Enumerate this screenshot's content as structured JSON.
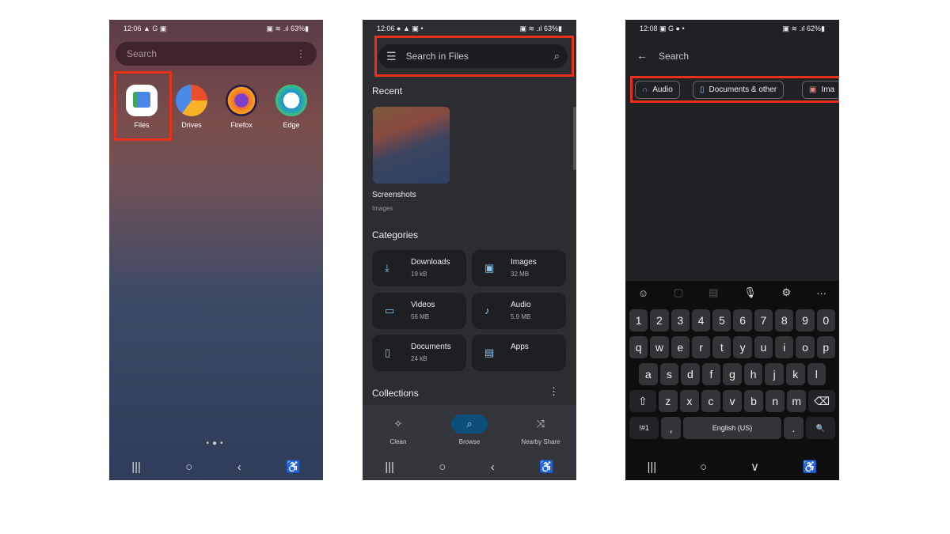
{
  "panel1": {
    "status": {
      "time": "12:06 ▲ G ▣",
      "right": "▣ ≋ .ıl 63%▮"
    },
    "search_placeholder": "Search",
    "menu_icon": "⋮",
    "apps": [
      {
        "label": "Files"
      },
      {
        "label": "Drives"
      },
      {
        "label": "Firefox"
      },
      {
        "label": "Edge"
      }
    ],
    "nav": [
      "|||",
      "○",
      "‹",
      "♿"
    ]
  },
  "panel2": {
    "status": {
      "time": "12:06 ● ▲ ▣ •",
      "right": "▣ ≋ .ıl 63%▮"
    },
    "search_placeholder": "Search in Files",
    "recent_title": "Recent",
    "recent_item": {
      "name": "Screenshots",
      "type": "Images"
    },
    "categories_title": "Categories",
    "categories": [
      {
        "label": "Downloads",
        "size": "19 kB",
        "icon": "⤓"
      },
      {
        "label": "Images",
        "size": "32 MB",
        "icon": "▣"
      },
      {
        "label": "Videos",
        "size": "56 MB",
        "icon": "▭"
      },
      {
        "label": "Audio",
        "size": "5.9 MB",
        "icon": "♪"
      },
      {
        "label": "Documents",
        "size": "24 kB",
        "icon": "▯"
      },
      {
        "label": "Apps",
        "icon": "▤"
      }
    ],
    "collections_title": "Collections",
    "bottom_nav": [
      {
        "label": "Clean",
        "icon": "✧"
      },
      {
        "label": "Browse",
        "icon": "⌕",
        "active": true
      },
      {
        "label": "Nearby Share",
        "icon": "⤨"
      }
    ],
    "accent": "#0b4f7a",
    "nav": [
      "|||",
      "○",
      "‹",
      "♿"
    ]
  },
  "panel3": {
    "status": {
      "time": "12:08 ▣ G ● •",
      "right": "▣ ≋ .ıl 62%▮"
    },
    "search_placeholder": "Search",
    "chips": [
      {
        "label": "Audio",
        "icon": "🎧"
      },
      {
        "label": "Documents & other",
        "icon": "▯"
      },
      {
        "label": "Ima",
        "icon": "▣"
      }
    ],
    "toolbar": [
      "☺",
      "▢",
      "▤",
      "🎙",
      "⚙",
      "···"
    ],
    "keys": [
      [
        "1",
        "2",
        "3",
        "4",
        "5",
        "6",
        "7",
        "8",
        "9",
        "0"
      ],
      [
        "q",
        "w",
        "e",
        "r",
        "t",
        "y",
        "u",
        "i",
        "o",
        "p"
      ],
      [
        "a",
        "s",
        "d",
        "f",
        "g",
        "h",
        "j",
        "k",
        "l"
      ],
      [
        "⇧",
        "z",
        "x",
        "c",
        "v",
        "b",
        "n",
        "m",
        "⌫"
      ],
      [
        "!#1",
        ",",
        "English (US)",
        ".",
        "🔍"
      ]
    ],
    "nav": [
      "|||",
      "○",
      "∨",
      "♿"
    ]
  },
  "highlight_color": "#e8301c"
}
